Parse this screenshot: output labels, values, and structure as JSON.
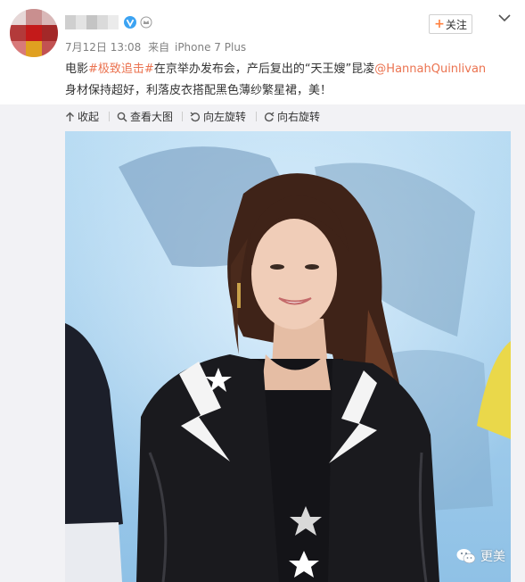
{
  "post": {
    "timestamp": "7月12日 13:08",
    "source_prefix": "来自",
    "source_device": "iPhone 7 Plus",
    "follow_label": "关注",
    "text": {
      "part1": "电影",
      "topic": "#极致追击#",
      "part2": "在京举办发布会，产后复出的“天王嫂”昆凌",
      "mention": "@HannahQuinlivan",
      "line2": "身材保持超好，利落皮衣搭配黑色薄纱繁星裙，美！"
    }
  },
  "toolbar": {
    "collapse_label": "收起",
    "view_large_label": "查看大图",
    "rotate_left_label": "向左旋转",
    "rotate_right_label": "向右旋转"
  },
  "watermark": {
    "text": "更美"
  },
  "colors": {
    "link": "#eb7350",
    "follow_plus": "#ff8140",
    "verified_badge": "#3ca3f2",
    "toolbar_bg": "#f2f2f5",
    "meta_text": "#808080"
  },
  "icons": {
    "verified": "verified-v-icon",
    "vip": "crown-icon",
    "collapse": "arrow-up-icon",
    "view_large": "magnifier-icon",
    "rotate_left": "rotate-left-icon",
    "rotate_right": "rotate-right-icon",
    "more": "chevron-down-icon",
    "watermark": "wechat-icon"
  }
}
